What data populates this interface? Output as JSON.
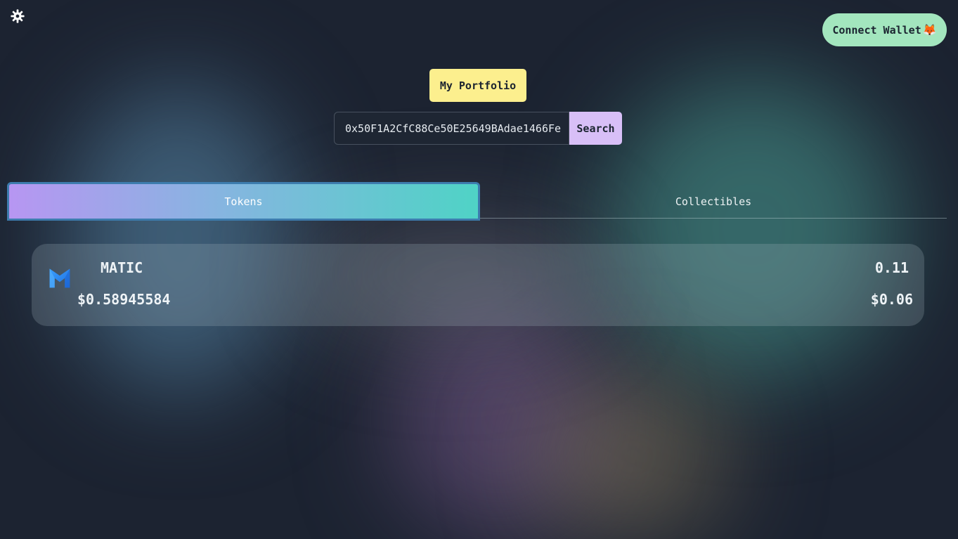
{
  "header": {
    "settings_icon": "gear-icon",
    "connect_wallet_label": "Connect Wallet",
    "wallet_emoji": "🦊"
  },
  "portfolio_button": "My Portfolio",
  "search": {
    "address_value": "0x50F1A2CfC88Ce50E25649BAdae1466Fe",
    "button_label": "Search"
  },
  "tabs": [
    {
      "label": "Tokens",
      "active": true
    },
    {
      "label": "Collectibles",
      "active": false
    }
  ],
  "tokens": [
    {
      "symbol": "MATIC",
      "icon": "matic-icon",
      "price": "$0.58945584",
      "amount": "0.11",
      "value": "$0.06"
    }
  ],
  "colors": {
    "connect_wallet_bg": "#a3e6be",
    "portfolio_bg": "#fcef8e",
    "search_bg": "#d8bff7",
    "tab_active_gradient_start": "#b796f2",
    "tab_active_gradient_end": "#4fd3c6",
    "matic_blue": "#2f8cf6"
  }
}
